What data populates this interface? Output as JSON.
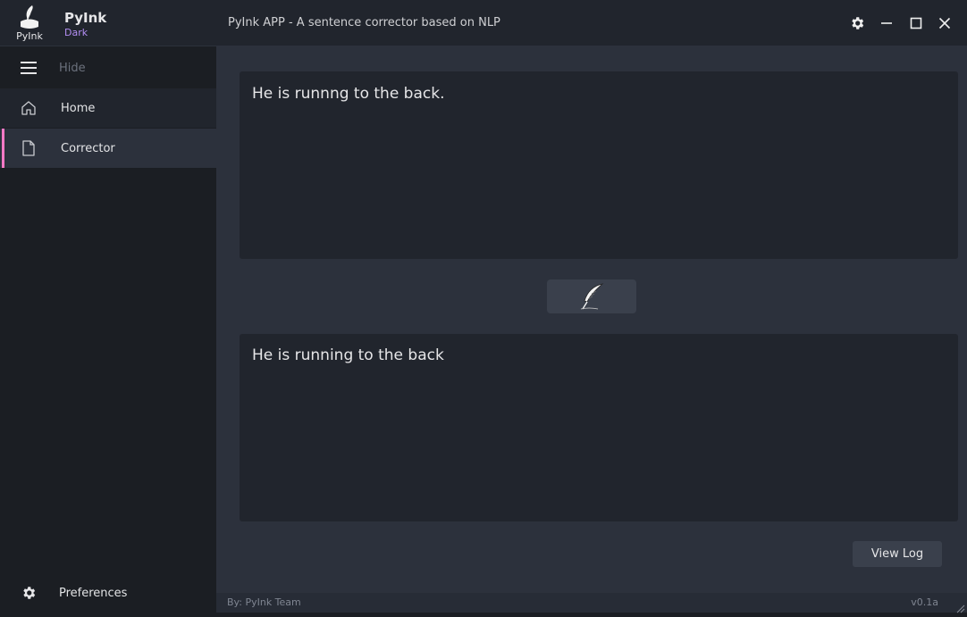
{
  "app": {
    "logo_text": "PyInk",
    "name": "PyInk",
    "theme": "Dark",
    "window_title": "PyInk APP - A sentence corrector based on NLP"
  },
  "sidebar": {
    "toggle_label": "Hide",
    "items": [
      {
        "label": "Home",
        "icon": "home-icon"
      },
      {
        "label": "Corrector",
        "icon": "file-icon",
        "active": true
      }
    ],
    "preferences_label": "Preferences"
  },
  "corrector": {
    "input_text": "He is runnng to the back.",
    "output_text": "He is running to the back",
    "correct_button_icon": "quill-icon",
    "view_log_label": "View Log"
  },
  "footer": {
    "credit": "By: PyInk Team",
    "version": "v0.1a"
  },
  "colors": {
    "accent": "#ff79c6",
    "theme_label": "#b38ef3",
    "background": "#2c313c",
    "panel": "#21252d"
  }
}
